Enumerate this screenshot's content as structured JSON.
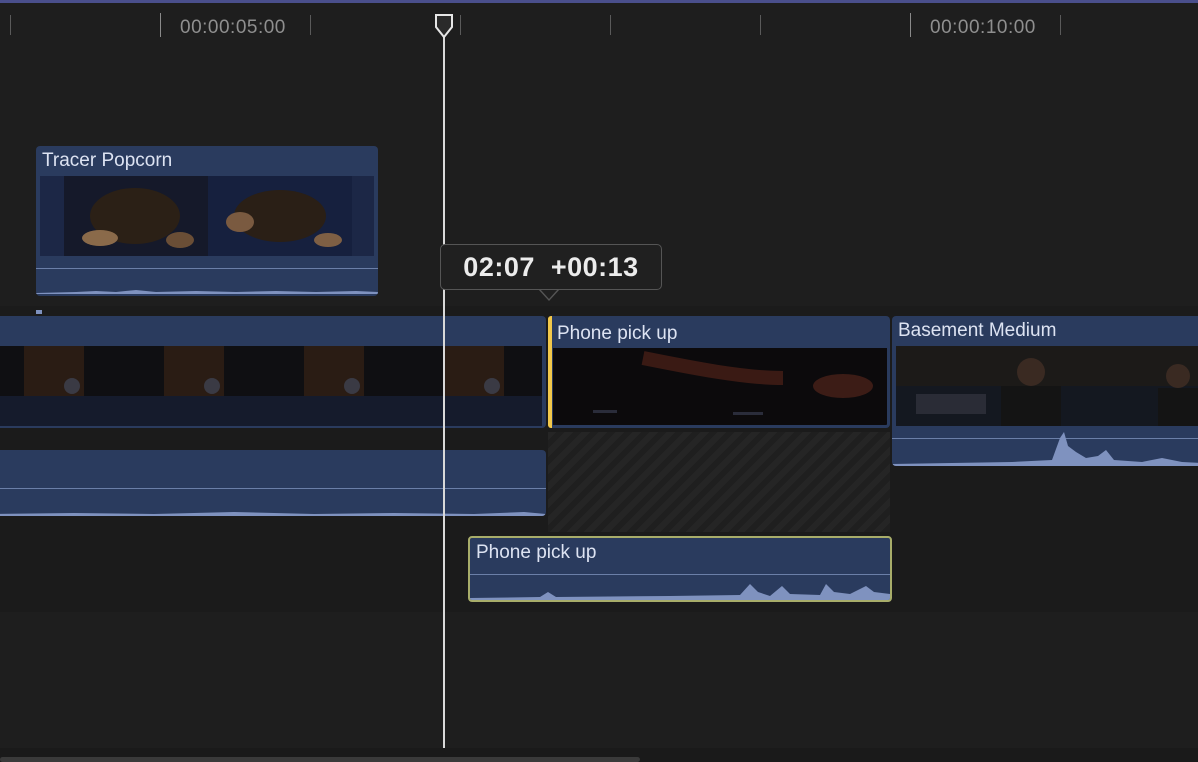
{
  "ruler": {
    "timecode_5": "00:00:05:00",
    "timecode_10": "00:00:10:00"
  },
  "clips": {
    "tracer_popcorn": {
      "title": "Tracer Popcorn"
    },
    "phone_pick_up_video": {
      "title": "Phone pick up"
    },
    "basement_medium": {
      "title": "Basement Medium"
    },
    "phone_pick_up_audio": {
      "title": "Phone pick up"
    }
  },
  "tooltip": {
    "time": "02:07",
    "delta": "+00:13"
  },
  "colors": {
    "clip_fill": "#2a3b5e",
    "trim_selection": "#f2c84b",
    "audio_selection": "#a8ad6a",
    "playhead": "#d8d8d8",
    "ruler_accent": "#4a4f8c"
  },
  "icons": {
    "playhead_handle": "playhead-icon"
  }
}
